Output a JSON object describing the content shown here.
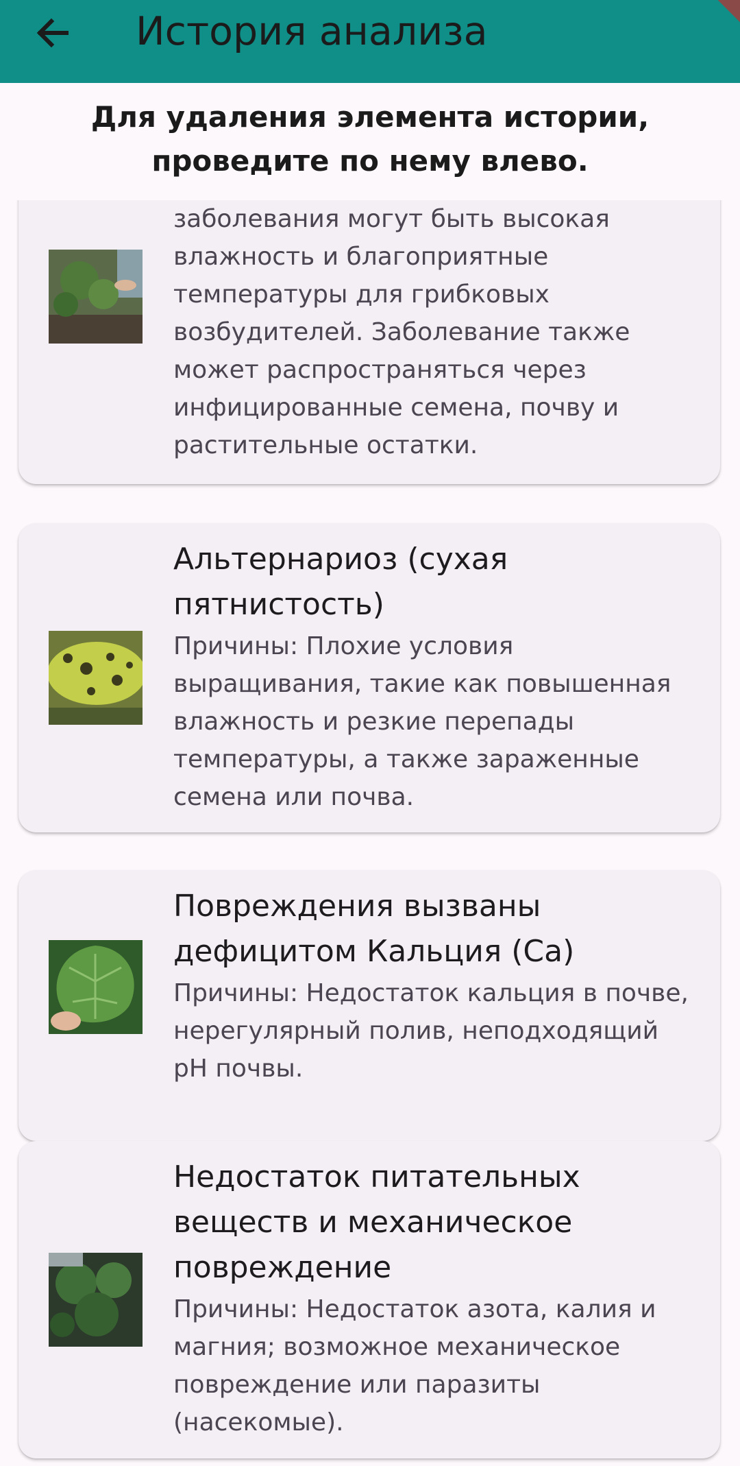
{
  "app_bar": {
    "title": "История анализа",
    "back_icon": "arrow-left-icon",
    "color": "#0f8f87"
  },
  "notice": "Для удаления элемента истории, проведите по нему влево.",
  "history": [
    {
      "title": "",
      "description": "заболевания могут быть высокая влажность и благоприятные температуры для грибковых возбудителей. Заболевание также может распространяться через инфицированные семена, почву и растительные остатки."
    },
    {
      "title": "Альтернариоз (сухая пятнистость)",
      "description": "Причины: Плохие условия выращивания, такие как повышенная влажность и резкие перепады температуры, а также зараженные семена или почва."
    },
    {
      "title": "Повреждения вызваны дефицитом Кальция (Ca)",
      "description": "Причины: Недостаток кальция в почве, нерегулярный полив, неподходящий pH почвы."
    },
    {
      "title": "Недостаток питательных веществ и механическое повреждение",
      "description": "Причины: Недостаток азота, калия и магния; возможное механическое повреждение или паразиты (насекомые)."
    }
  ]
}
